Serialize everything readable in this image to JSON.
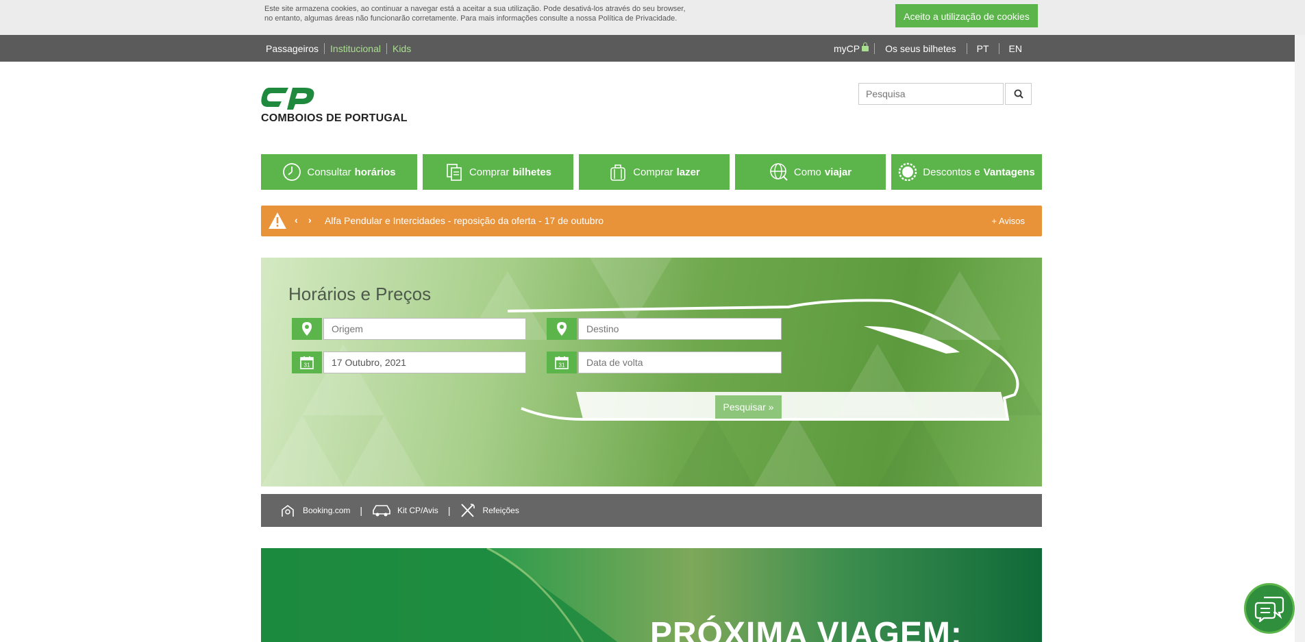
{
  "cookie": {
    "text_line1": "Este site armazena cookies, ao continuar a navegar está a aceitar a sua utilização. Pode desativá-los através do seu browser,",
    "text_line2": "no entanto, algumas áreas não funcionarão corretamente. Para mais informações consulte a nossa Política de Privacidade.",
    "accept_label": "Aceito a utilização de cookies"
  },
  "topnav": {
    "left": [
      "Passageiros",
      "Institucional",
      "Kids"
    ],
    "mycp": "myCP",
    "tickets": "Os seus bilhetes",
    "lang_pt": "PT",
    "lang_en": "EN"
  },
  "logo": {
    "text": "COMBOIOS DE PORTUGAL"
  },
  "search": {
    "placeholder": "Pesquisa"
  },
  "menu": [
    {
      "pre": "Consultar",
      "bold": "horários",
      "icon": "clock-icon"
    },
    {
      "pre": "Comprar",
      "bold": "bilhetes",
      "icon": "ticket-icon"
    },
    {
      "pre": "Comprar",
      "bold": "lazer",
      "icon": "luggage-icon"
    },
    {
      "pre": "Como",
      "bold": "viajar",
      "icon": "globe-icon"
    },
    {
      "pre": "Descontos e",
      "bold": "Vantagens",
      "icon": "badge-icon"
    }
  ],
  "alert": {
    "text": "Alfa Pendular e Intercidades - reposição da oferta - 17 de outubro",
    "more": "+ Avisos"
  },
  "booking": {
    "title": "Horários e Preços",
    "origin_placeholder": "Origem",
    "destination_placeholder": "Destino",
    "date_value": "17 Outubro, 2021",
    "return_placeholder": "Data de volta",
    "calendar_day": "31",
    "search_label": "Pesquisar »"
  },
  "services": [
    "Booking.com",
    "Kit CP/Avis",
    "Refeições"
  ],
  "promo": {
    "text": "PRÓXIMA VIAGEM:"
  },
  "colors": {
    "green": "#5cb54b",
    "orange": "#e8923a",
    "gray": "#5b5b5b"
  }
}
